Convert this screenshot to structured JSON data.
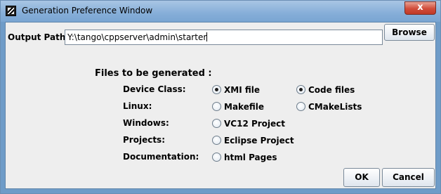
{
  "window": {
    "title": "Generation Preference  Window",
    "close_label": "x"
  },
  "output_path": {
    "label": "Output Path :",
    "value": "Y:\\tango\\cppserver\\admin\\starter",
    "browse_label": "Browse"
  },
  "files_section": {
    "heading": "Files to be generated :",
    "rows": [
      {
        "label": "Device Class:",
        "options": [
          {
            "label": "XMI   file",
            "checked": true
          },
          {
            "label": "Code files",
            "checked": true
          }
        ]
      },
      {
        "label": "Linux:",
        "options": [
          {
            "label": "Makefile",
            "checked": false
          },
          {
            "label": "CMakeLists",
            "checked": false
          }
        ]
      },
      {
        "label": "Windows:",
        "options": [
          {
            "label": "VC12 Project",
            "checked": false
          }
        ]
      },
      {
        "label": "Projects:",
        "options": [
          {
            "label": "Eclipse Project",
            "checked": false
          }
        ]
      },
      {
        "label": "Documentation:",
        "options": [
          {
            "label": "html Pages",
            "checked": false
          }
        ]
      }
    ]
  },
  "buttons": {
    "ok_label": "OK",
    "cancel_label": "Cancel"
  }
}
